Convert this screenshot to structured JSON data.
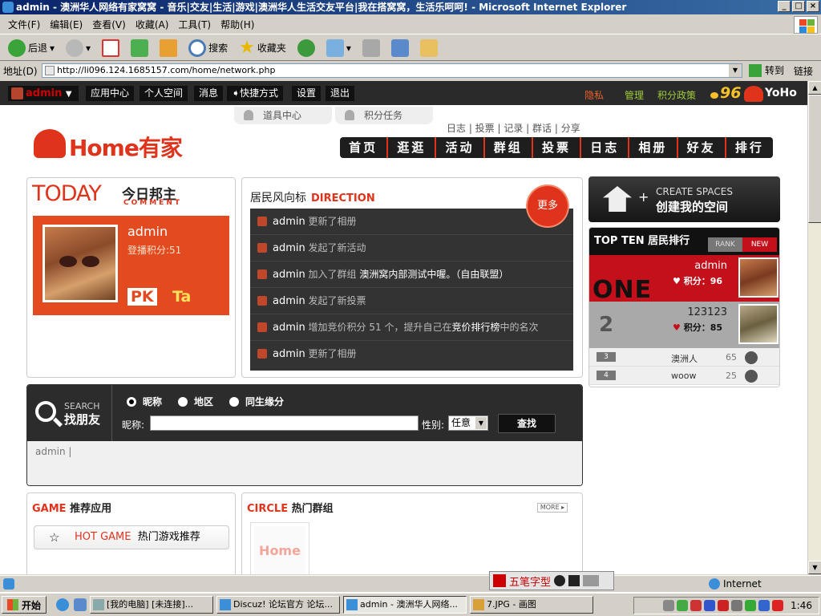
{
  "window": {
    "title": "admin - 澳洲华人网络有家窝窝 - 音乐|交友|生活|游戏|澳洲华人生活交友平台|我在搭窝窝，生活乐呵呵! - Microsoft Internet Explorer"
  },
  "menu": [
    "文件(F)",
    "编辑(E)",
    "查看(V)",
    "收藏(A)",
    "工具(T)",
    "帮助(H)"
  ],
  "toolbar": {
    "back": "后退",
    "search": "搜索",
    "favorites": "收藏夹"
  },
  "address": {
    "label": "地址(D)",
    "url": "http://li096.124.1685157.com/home/network.php",
    "go": "转到",
    "links": "链接"
  },
  "site": {
    "username": "admin",
    "topnav": [
      "应用中心",
      "个人空间",
      "消息",
      "➧快捷方式",
      "设置",
      "退出"
    ],
    "right_links": [
      "隐私",
      "管理",
      "积分政策"
    ],
    "points": "96",
    "brand": "YoHo",
    "subtabs": [
      "道具中心",
      "积分任务"
    ],
    "toplinks": "日志 | 投票 | 记录 | 群话 | 分享",
    "logo": "Home有家",
    "mainnav": [
      "首页",
      "逛逛",
      "活动",
      "群组",
      "投票",
      "日志",
      "相册",
      "好友",
      "排行"
    ]
  },
  "today": {
    "title": "TODAY",
    "cn": "今日邦主",
    "sub": "COMMENT",
    "name": "admin",
    "score": "登播积分:51",
    "pk": "PK",
    "ta": "Ta"
  },
  "direction": {
    "title": "居民风向标",
    "title_en": "DIRECTION",
    "more": "更多",
    "items": [
      {
        "user": "admin",
        "text": " 更新了相册"
      },
      {
        "user": "admin",
        "text": " 发起了新活动"
      },
      {
        "user": "admin",
        "text": " 加入了群组 ",
        "extra": "澳洲窝内部测试中喔。（自由联盟）"
      },
      {
        "user": "admin",
        "text": " 发起了新投票"
      },
      {
        "user": "admin",
        "text": " 增加竞价积分 51 个，提升自己在",
        "extra": "竞价排行榜",
        "tail": "中的名次"
      },
      {
        "user": "admin",
        "text": " 更新了相册"
      }
    ]
  },
  "create": {
    "en": "CREATE SPACES",
    "cn": "创建我的空间"
  },
  "rank": {
    "title": "TOP TEN 居民排行",
    "tab_rank": "RANK",
    "tab_new": "NEW",
    "first": {
      "label": "ONE",
      "name": "admin",
      "score": "积分：96"
    },
    "second": {
      "label": "2",
      "name": "123123",
      "score": "积分：85"
    },
    "rows": [
      {
        "num": "3",
        "name": "澳洲人",
        "score": "65"
      },
      {
        "num": "4",
        "name": "woow",
        "score": "25"
      }
    ]
  },
  "search": {
    "en": "SEARCH",
    "cn": "找朋友",
    "radios": [
      "昵称",
      "地区",
      "同生缘分"
    ],
    "nick_label": "昵称:",
    "gender_label": "性别:",
    "gender_value": "任意",
    "button": "查找",
    "result": "admin |"
  },
  "game": {
    "title_en": "GAME",
    "title_cn": " 推荐应用",
    "hot_en": "HOT GAME",
    "hot_cn": "热门游戏推荐",
    "star": "☆"
  },
  "circle": {
    "title_en": "CIRCLE",
    "title_cn": " 热门群组",
    "more": "MORE ▸",
    "thumb": "Home"
  },
  "status": {
    "zone": "Internet"
  },
  "ime": {
    "label": "五笔字型"
  },
  "taskbar": {
    "start": "开始",
    "tasks": [
      "[我的电脑] [未连接]...",
      "Discuz! 论坛官方 论坛...",
      "admin - 澳洲华人网络...",
      "7.JPG - 画图"
    ],
    "clock": "1:46"
  }
}
